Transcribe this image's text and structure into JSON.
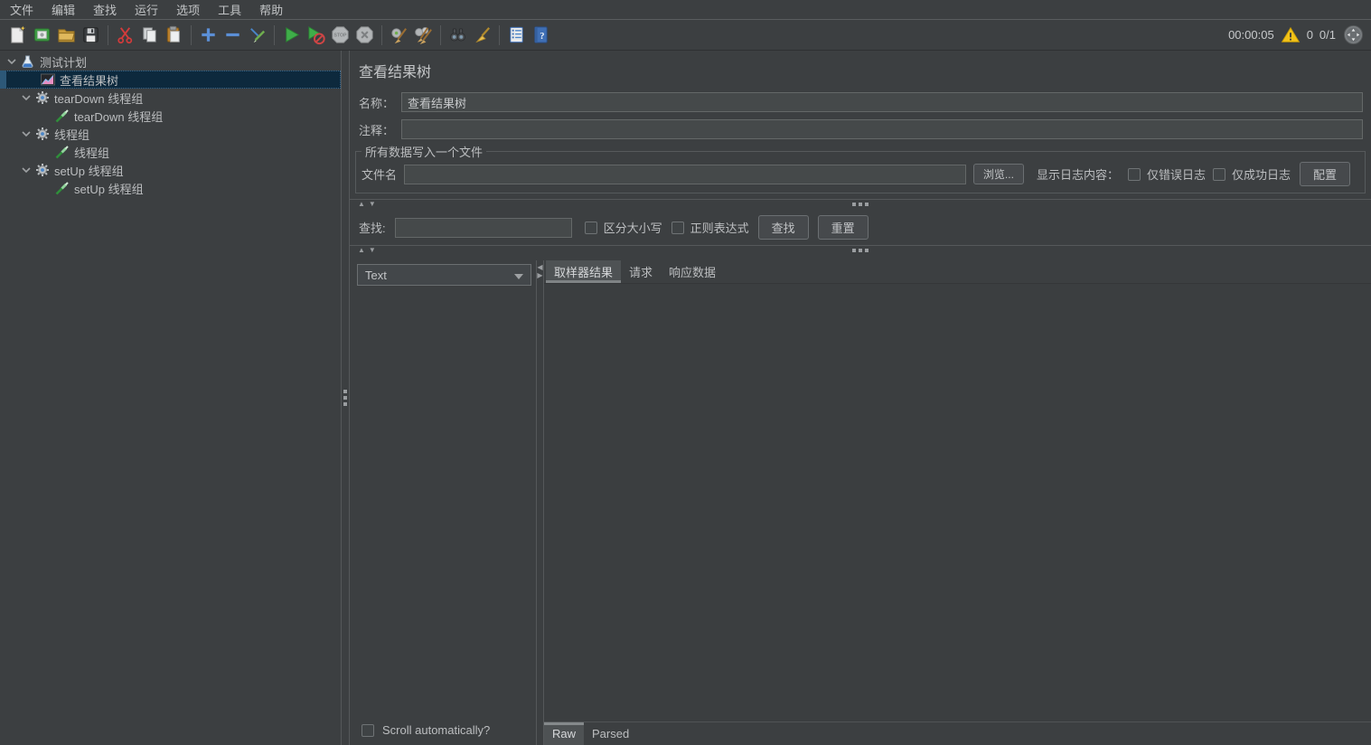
{
  "menu": {
    "items": [
      "文件",
      "编辑",
      "查找",
      "运行",
      "选项",
      "工具",
      "帮助"
    ]
  },
  "toolbar": {
    "icons": [
      "new-file-icon",
      "templates-icon",
      "open-folder-icon",
      "save-icon",
      "cut-icon",
      "copy-icon",
      "paste-icon",
      "add-icon",
      "remove-icon",
      "toggle-icon",
      "start-icon",
      "start-no-timers-icon",
      "stop-icon",
      "shutdown-icon",
      "clear-icon",
      "clear-all-icon",
      "search-icon",
      "clear-search-icon",
      "function-helper-icon",
      "help-icon"
    ],
    "status": {
      "elapsed": "00:00:05",
      "warnings": "0",
      "threads": "0/1"
    }
  },
  "tree": {
    "items": [
      {
        "label": "测试计划",
        "icon": "test-plan-icon",
        "level": 0,
        "expanded": true,
        "selected": false
      },
      {
        "label": "查看结果树",
        "icon": "results-tree-icon",
        "level": 1,
        "selected": true
      },
      {
        "label": "tearDown 线程组",
        "icon": "thread-group-icon",
        "level": 1,
        "expanded": true,
        "selected": false
      },
      {
        "label": "tearDown 线程组",
        "icon": "sampler-icon",
        "level": 2,
        "selected": false
      },
      {
        "label": "线程组",
        "icon": "thread-group-icon",
        "level": 1,
        "expanded": true,
        "selected": false
      },
      {
        "label": "线程组",
        "icon": "sampler-icon",
        "level": 2,
        "selected": false
      },
      {
        "label": "setUp 线程组",
        "icon": "thread-group-icon",
        "level": 1,
        "expanded": true,
        "selected": false
      },
      {
        "label": "setUp 线程组",
        "icon": "sampler-icon",
        "level": 2,
        "selected": false
      }
    ]
  },
  "main": {
    "title": "查看结果树",
    "name_label": "名称：",
    "name_value": "查看结果树",
    "comment_label": "注释：",
    "comment_value": "",
    "file_group": {
      "legend": "所有数据写入一个文件",
      "filename_label": "文件名",
      "filename_value": "",
      "browse_button": "浏览...",
      "log_display_label": "显示日志内容：",
      "errors_only_label": "仅错误日志",
      "errors_only_checked": false,
      "success_only_label": "仅成功日志",
      "success_only_checked": false,
      "config_button": "配置"
    },
    "search": {
      "label": "查找:",
      "value": "",
      "case_sensitive_label": "区分大小写",
      "case_sensitive_checked": false,
      "regex_label": "正则表达式",
      "regex_checked": false,
      "find_button": "查找",
      "reset_button": "重置"
    },
    "viewer": {
      "renderer_value": "Text",
      "tabs": [
        "取样器结果",
        "请求",
        "响应数据"
      ],
      "selected_tab": "取样器结果",
      "scroll_label": "Scroll automatically?",
      "scroll_checked": false,
      "bottom_tabs": [
        "Raw",
        "Parsed"
      ],
      "selected_bottom_tab": "Raw"
    }
  },
  "colors": {
    "background": "#3c3f41",
    "selection": "#0d293d",
    "selection_stripe": "#2d5878",
    "border": "#55585a",
    "input_bg": "#45494a",
    "warning_yellow": "#f2c218",
    "accent_green": "#3fae49",
    "accent_blue": "#5b8fd6"
  }
}
